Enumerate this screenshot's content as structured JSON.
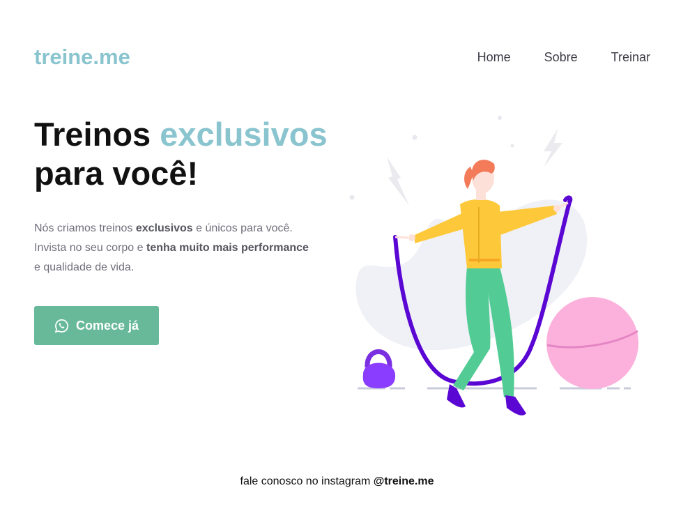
{
  "header": {
    "logo": "treine.me",
    "nav": [
      {
        "label": "Home"
      },
      {
        "label": "Sobre"
      },
      {
        "label": "Treinar"
      }
    ]
  },
  "hero": {
    "title_part1": "Treinos ",
    "title_accent": "exclusivos",
    "title_part2": "para você!",
    "text_1": "Nós criamos treinos ",
    "text_bold_1": "exclusivos",
    "text_2": " e únicos para você.",
    "text_3": "Invista no seu corpo e ",
    "text_bold_2": "tenha muito mais performance",
    "text_4": "e qualidade de vida.",
    "cta_label": "Comece já",
    "cta_icon": "whatsapp-icon"
  },
  "illustration": {
    "icon": "woman-jumping-rope-illustration"
  },
  "footer": {
    "text": "fale conosco no instagram ",
    "handle": "@treine.me"
  },
  "colors": {
    "brand": "#89c4cf",
    "cta": "#67b99a",
    "text_dark": "#111111",
    "text_muted": "#6f6f7c"
  }
}
